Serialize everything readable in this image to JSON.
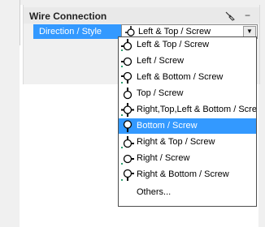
{
  "panel": {
    "title": "Wire Connection",
    "collapse_glyph": "−",
    "pin_icon": "pin-icon",
    "property": {
      "name": "Direction / Style",
      "value": "Left & Top / Screw",
      "value_icon": "left-top-screw-icon"
    }
  },
  "dropdown": {
    "selected_index": 6,
    "items": [
      {
        "label": "Left & Top / Screw",
        "icon": "left-top-screw-icon"
      },
      {
        "label": "Left / Screw",
        "icon": "left-screw-icon"
      },
      {
        "label": "Left & Bottom / Screw",
        "icon": "left-bottom-screw-icon"
      },
      {
        "label": "Top / Screw",
        "icon": "top-screw-icon"
      },
      {
        "label": "Right,Top,Left & Bottom / Scre",
        "icon": "all-directions-screw-icon"
      },
      {
        "label": "Bottom / Screw",
        "icon": "bottom-screw-icon"
      },
      {
        "label": "Right & Top / Screw",
        "icon": "right-top-screw-icon"
      },
      {
        "label": "Right / Screw",
        "icon": "right-screw-icon"
      },
      {
        "label": "Right & Bottom / Screw",
        "icon": "right-bottom-screw-icon"
      },
      {
        "label": "Others...",
        "icon": ""
      }
    ]
  },
  "colors": {
    "selection": "#3399ff",
    "wire_green": "#2e9e6e",
    "panel_bg": "#f0f0f0"
  }
}
